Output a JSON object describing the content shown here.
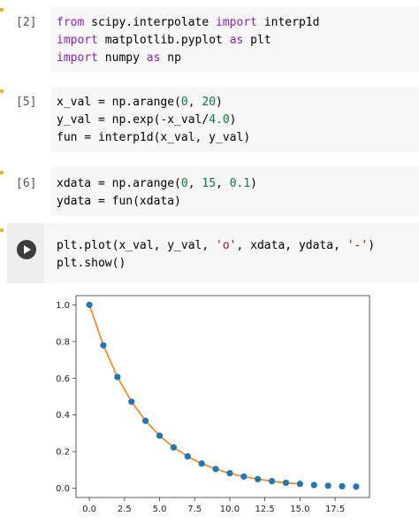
{
  "cells": [
    {
      "prompt": "[2]",
      "lines": [
        [
          {
            "t": "from",
            "c": "kw"
          },
          {
            "t": " scipy.interpolate ",
            "c": "op"
          },
          {
            "t": "import",
            "c": "kw"
          },
          {
            "t": " interp1d",
            "c": "op"
          }
        ],
        [
          {
            "t": "import",
            "c": "kw"
          },
          {
            "t": " matplotlib.pyplot ",
            "c": "op"
          },
          {
            "t": "as",
            "c": "kw"
          },
          {
            "t": " plt",
            "c": "op"
          }
        ],
        [
          {
            "t": "import",
            "c": "kw"
          },
          {
            "t": " numpy ",
            "c": "op"
          },
          {
            "t": "as",
            "c": "kw"
          },
          {
            "t": " np",
            "c": "op"
          }
        ]
      ]
    },
    {
      "prompt": "[5]",
      "lines": [
        [
          {
            "t": "x_val = np.arange(",
            "c": "op"
          },
          {
            "t": "0",
            "c": "num"
          },
          {
            "t": ", ",
            "c": "op"
          },
          {
            "t": "20",
            "c": "num"
          },
          {
            "t": ")",
            "c": "op"
          }
        ],
        [
          {
            "t": "y_val = np.exp(-x_val/",
            "c": "op"
          },
          {
            "t": "4.0",
            "c": "num"
          },
          {
            "t": ")",
            "c": "op"
          }
        ],
        [
          {
            "t": "fun = interp1d(x_val, y_val)",
            "c": "op"
          }
        ]
      ]
    },
    {
      "prompt": "[6]",
      "lines": [
        [
          {
            "t": "xdata = np.arange(",
            "c": "op"
          },
          {
            "t": "0",
            "c": "num"
          },
          {
            "t": ", ",
            "c": "op"
          },
          {
            "t": "15",
            "c": "num"
          },
          {
            "t": ", ",
            "c": "op"
          },
          {
            "t": "0.1",
            "c": "num"
          },
          {
            "t": ")",
            "c": "op"
          }
        ],
        [
          {
            "t": "ydata = fun(xdata)",
            "c": "op"
          }
        ]
      ]
    }
  ],
  "run_cell": {
    "lines": [
      [
        {
          "t": "plt.plot(x_val, y_val, ",
          "c": "op"
        },
        {
          "t": "'o'",
          "c": "str"
        },
        {
          "t": ", xdata, ydata, ",
          "c": "op"
        },
        {
          "t": "'-'",
          "c": "str"
        },
        {
          "t": ")",
          "c": "op"
        }
      ],
      [
        {
          "t": "plt.show()",
          "c": "op"
        }
      ]
    ]
  },
  "chart_data": {
    "type": "line",
    "xlim": [
      -0.95,
      19.95
    ],
    "ylim": [
      -0.05,
      1.05
    ],
    "xticks": [
      0.0,
      2.5,
      5.0,
      7.5,
      10.0,
      12.5,
      15.0,
      17.5
    ],
    "xtick_labels": [
      "0.0",
      "2.5",
      "5.0",
      "7.5",
      "10.0",
      "12.5",
      "15.0",
      "17.5"
    ],
    "yticks": [
      0.0,
      0.2,
      0.4,
      0.6,
      0.8,
      1.0
    ],
    "ytick_labels": [
      "0.0",
      "0.2",
      "0.4",
      "0.6",
      "0.8",
      "1.0"
    ],
    "series": [
      {
        "style": "markers",
        "color": "#1f77b4",
        "x": [
          0,
          1,
          2,
          3,
          4,
          5,
          6,
          7,
          8,
          9,
          10,
          11,
          12,
          13,
          14,
          15,
          16,
          17,
          18,
          19
        ],
        "y": [
          1.0,
          0.779,
          0.607,
          0.472,
          0.368,
          0.287,
          0.223,
          0.174,
          0.135,
          0.105,
          0.082,
          0.064,
          0.05,
          0.039,
          0.03,
          0.024,
          0.018,
          0.014,
          0.011,
          0.009
        ]
      },
      {
        "style": "line",
        "color": "#ff7f0e",
        "x": [
          0,
          1,
          2,
          3,
          4,
          5,
          6,
          7,
          8,
          9,
          10,
          11,
          12,
          13,
          14,
          15
        ],
        "y": [
          1.0,
          0.779,
          0.607,
          0.472,
          0.368,
          0.287,
          0.223,
          0.174,
          0.135,
          0.105,
          0.082,
          0.064,
          0.05,
          0.039,
          0.03,
          0.024
        ]
      }
    ]
  }
}
